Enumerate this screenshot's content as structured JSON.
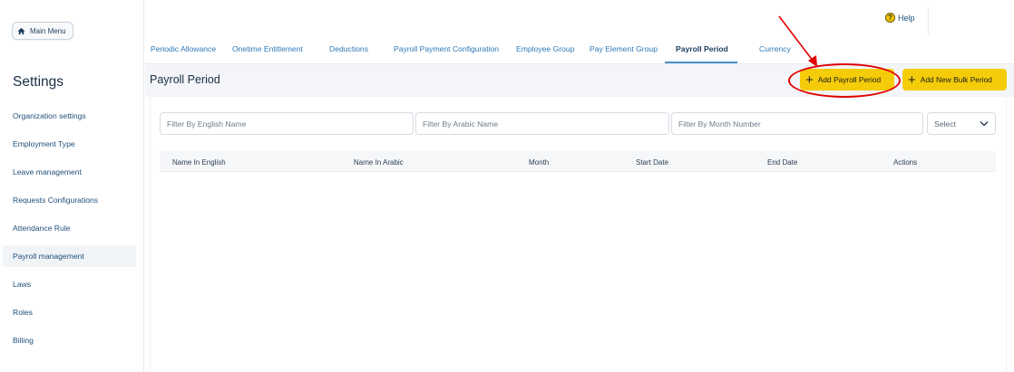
{
  "sidebar": {
    "main_menu_label": "Main Menu",
    "title": "Settings",
    "items": [
      {
        "label": "Organization settings"
      },
      {
        "label": "Employment Type"
      },
      {
        "label": "Leave management"
      },
      {
        "label": "Requests Configurations"
      },
      {
        "label": "Attendance Rule"
      },
      {
        "label": "Payroll management"
      },
      {
        "label": "Laws"
      },
      {
        "label": "Roles"
      },
      {
        "label": "Billing"
      }
    ]
  },
  "header": {
    "help_label": "Help",
    "tabs": [
      {
        "label": "Periodic Allowance"
      },
      {
        "label": "Onetime Entitlement"
      },
      {
        "label": "Deductions"
      },
      {
        "label": "Payroll Payment Configuration"
      },
      {
        "label": "Employee Group"
      },
      {
        "label": "Pay Element Group"
      },
      {
        "label": "Payroll Period"
      },
      {
        "label": "Currency"
      }
    ],
    "active_tab": "Payroll Period"
  },
  "page": {
    "title": "Payroll Period",
    "add_button_label": "Add Payroll Period",
    "bulk_button_label": "Add New Bulk Period"
  },
  "filters": {
    "english_placeholder": "Filter By English Name",
    "arabic_placeholder": "Filter By Arabic Name",
    "month_placeholder": "Filter By Month Number",
    "select_value": "Select"
  },
  "table": {
    "columns": [
      "Name In English",
      "Name In Arabic",
      "Month",
      "Start Date",
      "End Date",
      "Actions"
    ],
    "rows": []
  },
  "colors": {
    "accent_yellow": "#f5cc0a",
    "annotation_red": "#e00000",
    "tab_blue": "#2d78b6"
  }
}
